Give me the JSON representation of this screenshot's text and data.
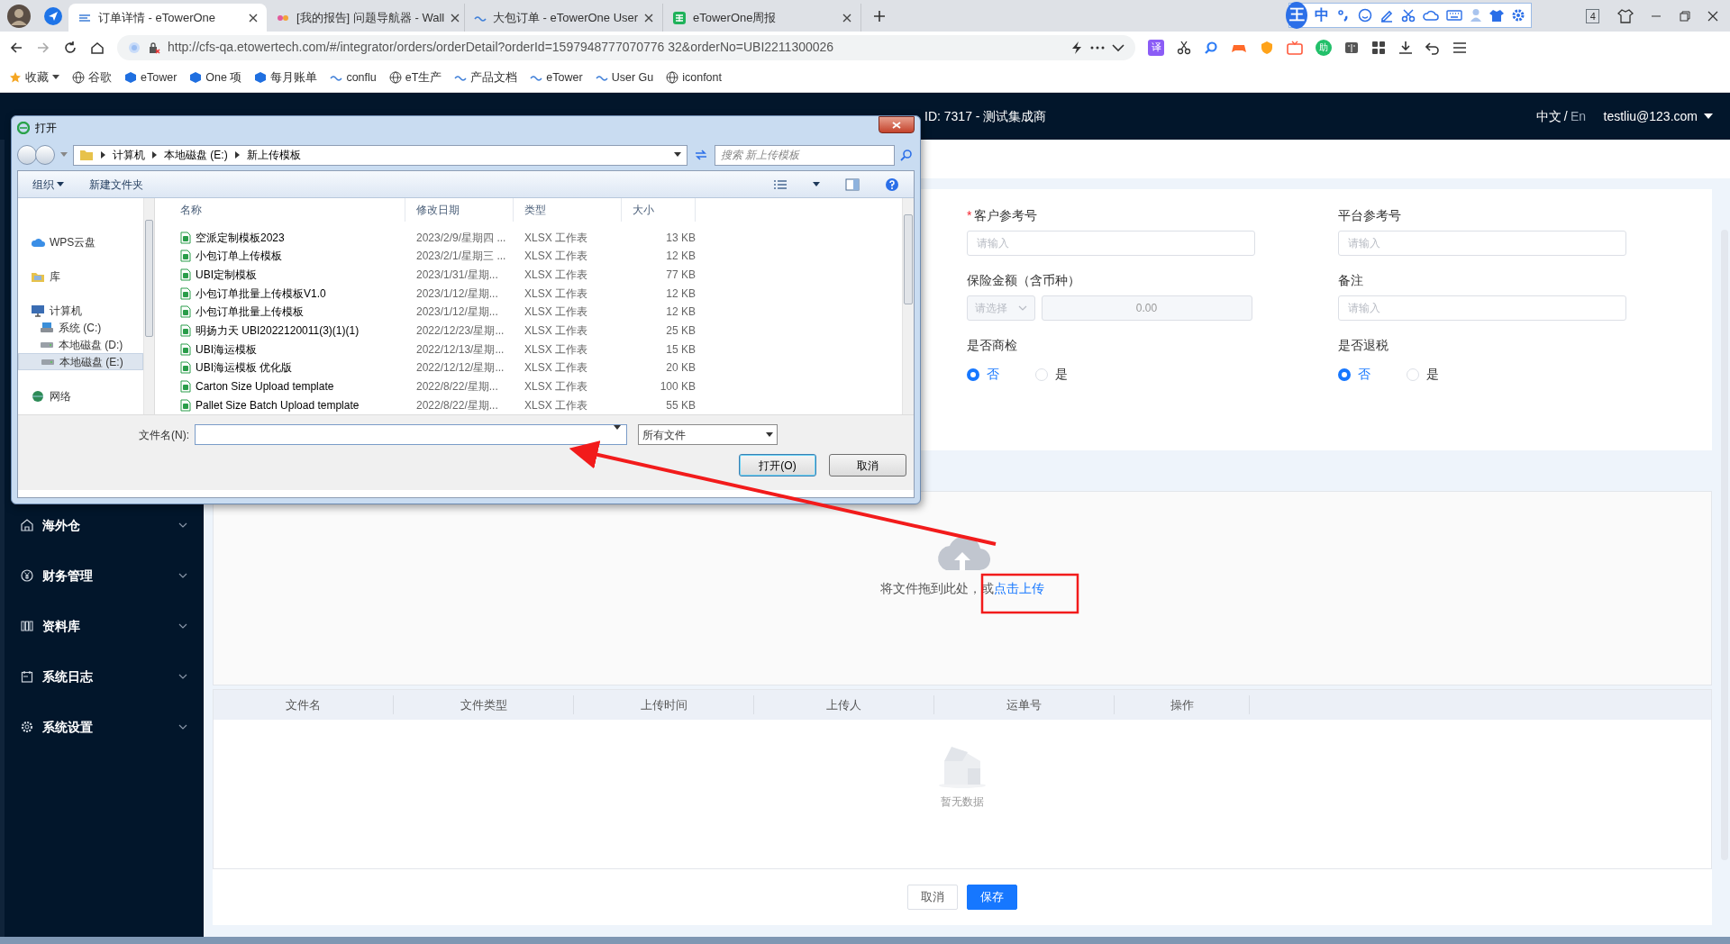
{
  "browser": {
    "tabs": [
      {
        "title": "订单详情 - eTowerOne",
        "selected": true
      },
      {
        "title": "[我的报告] 问题导航器 - Wall",
        "selected": false
      },
      {
        "title": "大包订单 - eTowerOne User",
        "selected": false
      },
      {
        "title": "eTowerOne周报",
        "selected": false
      }
    ],
    "ime": {
      "logo": "王",
      "mode": "中"
    },
    "tab_count": "4",
    "address": "http://cfs-qa.etowertech.com/#/integrator/orders/orderDetail?orderId=1597948777070776 32&orderNo=UBI2211300026",
    "extension_texts": [
      "译",
      "助"
    ],
    "bookmarks": [
      "收藏",
      "谷歌",
      "eTower",
      "One 项",
      "每月账单",
      "conflu",
      "eT生产",
      "产品文档",
      "eTower",
      "User Gu",
      "iconfont"
    ]
  },
  "header": {
    "org": "ID: 7317 - 测试集成商",
    "lang_current": "中文",
    "lang_separator": "/",
    "lang_other": "En",
    "user": "testliu@123.com"
  },
  "sidebar": [
    {
      "label": "海外仓"
    },
    {
      "label": "财务管理"
    },
    {
      "label": "资料库"
    },
    {
      "label": "系统日志"
    },
    {
      "label": "系统设置"
    }
  ],
  "form": {
    "required_mark": "*",
    "fields": [
      {
        "kind": "input",
        "label": "客户参考号",
        "required": true,
        "placeholder": "请输入"
      },
      {
        "kind": "input",
        "label": "平台参考号",
        "required": false,
        "placeholder": "请输入"
      },
      {
        "kind": "money",
        "label": "保险金额（含币种）",
        "required": false,
        "disabled": true,
        "placeholder": "请选择",
        "value": "0.00"
      },
      {
        "kind": "input",
        "label": "备注",
        "required": false,
        "placeholder": "请输入"
      },
      {
        "kind": "radio",
        "label": "是否商检",
        "required": false,
        "options": [
          {
            "label": "否",
            "selected": true
          },
          {
            "label": "是",
            "selected": false
          }
        ]
      },
      {
        "kind": "radio",
        "label": "是否退税",
        "required": false,
        "options": [
          {
            "label": "否",
            "selected": true
          },
          {
            "label": "是",
            "selected": false
          }
        ]
      }
    ]
  },
  "upload": {
    "hint": "将文件拖到此处，或",
    "link": "点击上传"
  },
  "files_table": {
    "columns": [
      "文件名",
      "文件类型",
      "上传时间",
      "上传人",
      "运单号",
      "操作"
    ],
    "empty_text": "暂无数据"
  },
  "actions": [
    {
      "label": "取消",
      "primary": false
    },
    {
      "label": "保存",
      "primary": true
    }
  ],
  "dialog": {
    "title": "打开",
    "breadcrumb": [
      "计算机",
      "本地磁盘 (E:)",
      "新上传模板"
    ],
    "search_placeholder": "搜索 新上传模板",
    "toolbar": [
      "组织",
      "新建文件夹"
    ],
    "nav": [
      {
        "label": "WPS云盘",
        "selected": false
      },
      {
        "label": "库",
        "selected": false
      },
      {
        "label": "计算机",
        "selected": false,
        "children": [
          {
            "label": "系统 (C:)",
            "selected": false
          },
          {
            "label": "本地磁盘 (D:)",
            "selected": false
          },
          {
            "label": "本地磁盘 (E:)",
            "selected": true
          }
        ]
      },
      {
        "label": "网络",
        "selected": false
      }
    ],
    "columns": [
      "名称",
      "修改日期",
      "类型",
      "大小"
    ],
    "files": [
      {
        "name": "空派定制模板2023",
        "modified": "2023/2/9/星期四 ...",
        "type": "XLSX 工作表",
        "size": "13 KB"
      },
      {
        "name": "小包订单上传模板",
        "modified": "2023/2/1/星期三 ...",
        "type": "XLSX 工作表",
        "size": "12 KB"
      },
      {
        "name": "UBI定制模板",
        "modified": "2023/1/31/星期...",
        "type": "XLSX 工作表",
        "size": "77 KB"
      },
      {
        "name": "小包订单批量上传模板V1.0",
        "modified": "2023/1/12/星期...",
        "type": "XLSX 工作表",
        "size": "12 KB"
      },
      {
        "name": "小包订单批量上传模板",
        "modified": "2023/1/12/星期...",
        "type": "XLSX 工作表",
        "size": "12 KB"
      },
      {
        "name": "明扬力天 UBI2022120011(3)(1)(1)",
        "modified": "2022/12/23/星期...",
        "type": "XLSX 工作表",
        "size": "25 KB"
      },
      {
        "name": "UBI海运模板",
        "modified": "2022/12/13/星期...",
        "type": "XLSX 工作表",
        "size": "15 KB"
      },
      {
        "name": "UBI海运模板 优化版",
        "modified": "2022/12/12/星期...",
        "type": "XLSX 工作表",
        "size": "20 KB"
      },
      {
        "name": "Carton Size Upload template",
        "modified": "2022/8/22/星期...",
        "type": "XLSX 工作表",
        "size": "100 KB"
      },
      {
        "name": "Pallet Size Batch Upload template",
        "modified": "2022/8/22/星期...",
        "type": "XLSX 工作表",
        "size": "55 KB"
      }
    ],
    "filename_label": "文件名(N):",
    "filter": "所有文件",
    "buttons": [
      {
        "label": "打开(O)",
        "default": true
      },
      {
        "label": "取消",
        "default": false
      }
    ]
  }
}
